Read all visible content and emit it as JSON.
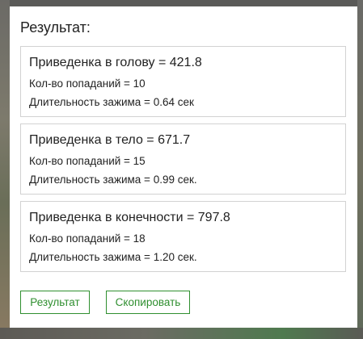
{
  "panel": {
    "title": "Результат:"
  },
  "cards": [
    {
      "heading": "Приведенка в голову = 421.8",
      "hits": "Кол-во попаданий = 10",
      "hold": "Длительность зажима = 0.64 сек"
    },
    {
      "heading": "Приведенка в тело = 671.7",
      "hits": "Кол-во попаданий = 15",
      "hold": "Длительность зажима = 0.99 сек."
    },
    {
      "heading": "Приведенка в конечности = 797.8",
      "hits": "Кол-во попаданий = 18",
      "hold": "Длительность зажима = 1.20 сек."
    }
  ],
  "buttons": {
    "result_label": "Результат",
    "copy_label": "Скопировать"
  },
  "colors": {
    "accent": "#2f8f2f",
    "card_border": "#d2d2d2",
    "text": "#222222"
  }
}
